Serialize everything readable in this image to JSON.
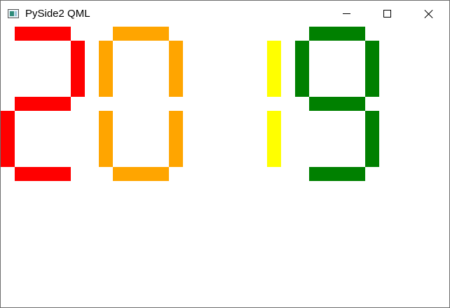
{
  "window": {
    "title": "PySide2 QML",
    "app_icon": "qt-app-icon",
    "controls": {
      "minimize_icon": "minimize-icon",
      "maximize_icon": "maximize-icon",
      "close_icon": "close-icon"
    }
  },
  "display": {
    "digits": [
      {
        "name": "digit-2",
        "value": "2",
        "color": "#ff0000",
        "segments": [
          "a",
          "b",
          "g",
          "e",
          "d"
        ]
      },
      {
        "name": "digit-0",
        "value": "0",
        "color": "#ffa500",
        "segments": [
          "a",
          "b",
          "c",
          "d",
          "e",
          "f"
        ]
      },
      {
        "name": "digit-1",
        "value": "1",
        "color": "#ffff00",
        "segments": [
          "b",
          "c"
        ]
      },
      {
        "name": "digit-9",
        "value": "9",
        "color": "#008000",
        "segments": [
          "a",
          "b",
          "c",
          "d",
          "f",
          "g"
        ]
      }
    ]
  }
}
